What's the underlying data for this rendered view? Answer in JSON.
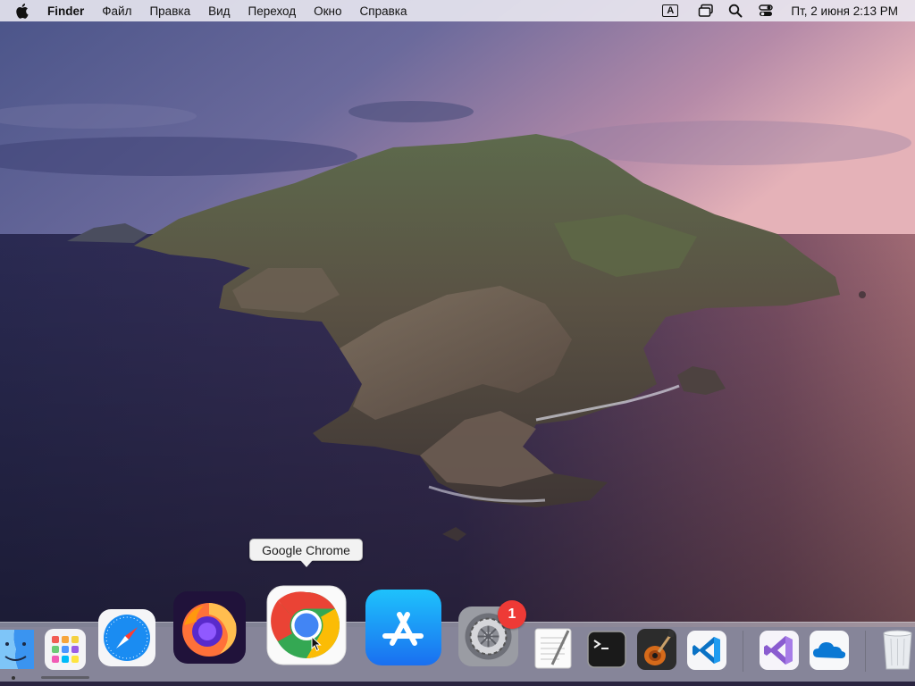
{
  "menubar": {
    "app_name": "Finder",
    "menus": [
      "Файл",
      "Правка",
      "Вид",
      "Переход",
      "Окно",
      "Справка"
    ],
    "keyboard_indicator": "A",
    "clock": "Пт, 2 июня  2:13 PM"
  },
  "tooltip": {
    "text": "Google Chrome"
  },
  "dock": {
    "items": [
      {
        "name": "Finder",
        "icon": "finder-icon"
      },
      {
        "name": "Launchpad",
        "icon": "launchpad-icon"
      },
      {
        "name": "Safari",
        "icon": "safari-icon"
      },
      {
        "name": "Firefox",
        "icon": "firefox-icon"
      },
      {
        "name": "Google Chrome",
        "icon": "chrome-icon"
      },
      {
        "name": "App Store",
        "icon": "app-store-icon"
      },
      {
        "name": "System Preferences",
        "icon": "system-preferences-icon"
      },
      {
        "name": "TextEdit",
        "icon": "textedit-icon"
      },
      {
        "name": "Terminal",
        "icon": "terminal-icon"
      },
      {
        "name": "GarageBand",
        "icon": "garageband-icon"
      },
      {
        "name": "Visual Studio Code",
        "icon": "vscode-icon"
      },
      {
        "name": "Visual Studio",
        "icon": "visual-studio-icon"
      },
      {
        "name": "OneDrive",
        "icon": "onedrive-icon"
      },
      {
        "name": "Trash",
        "icon": "trash-icon"
      }
    ],
    "system_preferences_badge": "1"
  },
  "colors": {
    "badge": "#ee3a36",
    "chrome_red": "#ea4335",
    "chrome_yellow": "#fbbc05",
    "chrome_green": "#34a853",
    "chrome_blue": "#4285f4",
    "app_store_blue": "#1a8cf2"
  }
}
